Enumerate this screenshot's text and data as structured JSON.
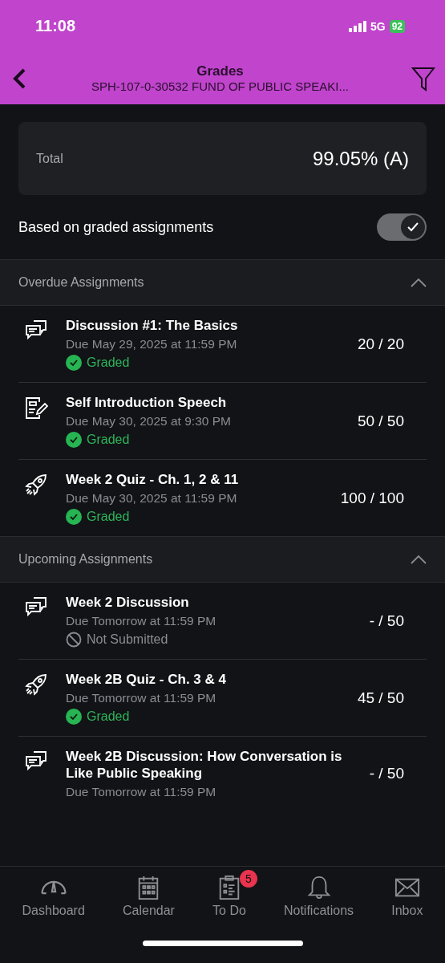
{
  "status_bar": {
    "time": "11:08",
    "network": "5G",
    "battery": "92"
  },
  "header": {
    "title": "Grades",
    "subtitle": "SPH-107-0-30532 FUND OF PUBLIC SPEAKI..."
  },
  "total": {
    "label": "Total",
    "value": "99.05% (A)"
  },
  "graded_toggle": {
    "label": "Based on graded assignments",
    "on": true
  },
  "sections": [
    {
      "title": "Overdue Assignments",
      "expanded": true,
      "items": [
        {
          "kind": "discussion",
          "title": "Discussion #1: The Basics",
          "due": "Due May 29, 2025 at 11:59 PM",
          "status": {
            "kind": "graded",
            "label": "Graded"
          },
          "score": "20 / 20"
        },
        {
          "kind": "assignment",
          "title": "Self Introduction Speech",
          "due": "Due May 30, 2025 at 9:30 PM",
          "status": {
            "kind": "graded",
            "label": "Graded"
          },
          "score": "50 / 50"
        },
        {
          "kind": "quiz",
          "title": "Week 2 Quiz - Ch. 1, 2 & 11",
          "due": "Due May 30, 2025 at 11:59 PM",
          "status": {
            "kind": "graded",
            "label": "Graded"
          },
          "score": "100 / 100"
        }
      ]
    },
    {
      "title": "Upcoming Assignments",
      "expanded": true,
      "items": [
        {
          "kind": "discussion",
          "title": "Week 2 Discussion",
          "due": "Due Tomorrow at 11:59 PM",
          "status": {
            "kind": "not_submitted",
            "label": "Not Submitted"
          },
          "score": "- / 50"
        },
        {
          "kind": "quiz",
          "title": "Week 2B Quiz - Ch. 3 & 4",
          "due": "Due Tomorrow at 11:59 PM",
          "status": {
            "kind": "graded",
            "label": "Graded"
          },
          "score": "45 / 50"
        },
        {
          "kind": "discussion",
          "title": "Week 2B Discussion: How Conversation is Like Public Speaking",
          "due": "Due Tomorrow at 11:59 PM",
          "score": "- / 50"
        }
      ]
    }
  ],
  "tab_bar": [
    {
      "kind": "dashboard",
      "label": "Dashboard"
    },
    {
      "kind": "calendar",
      "label": "Calendar"
    },
    {
      "kind": "todo",
      "label": "To Do",
      "badge": "5"
    },
    {
      "kind": "notifications",
      "label": "Notifications"
    },
    {
      "kind": "inbox",
      "label": "Inbox"
    }
  ]
}
